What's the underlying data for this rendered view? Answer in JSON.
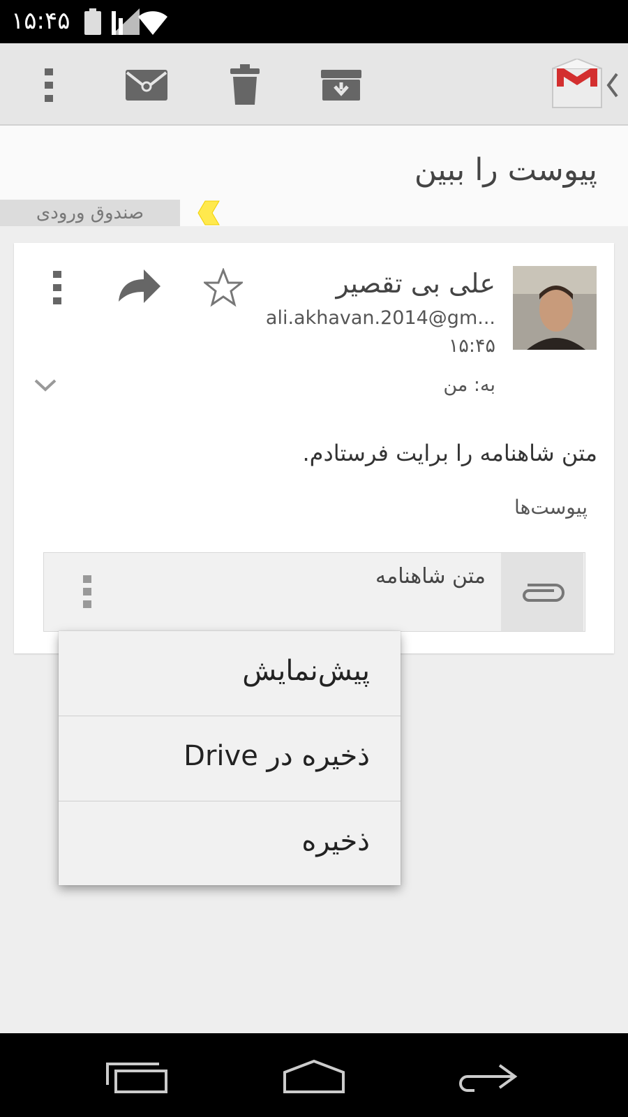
{
  "status_bar": {
    "time": "۱۵:۴۵"
  },
  "toolbar": {
    "icons": [
      "overflow-menu-icon",
      "mark-unread-icon",
      "delete-icon",
      "archive-icon",
      "gmail-logo-icon",
      "back-chevron-icon"
    ]
  },
  "conversation": {
    "subject": "پیوست را ببین",
    "label": "صندوق ورودی"
  },
  "message": {
    "sender_name": "علی بی تقصیر",
    "sender_email": "ali.akhavan.2014@gm...",
    "time": "۱۵:۴۵",
    "to_line": "به: من",
    "body": "متن شاهنامه را برایت فرستادم.",
    "attachments_heading": "پیوست‌ها"
  },
  "attachment": {
    "name": "متن شاهنامه"
  },
  "popup_menu": {
    "items": [
      {
        "label": "پیش‌نمایش"
      },
      {
        "label": "ذخیره در Drive"
      },
      {
        "label": "ذخیره"
      }
    ]
  },
  "colors": {
    "gmail_red": "#d32f2f",
    "label_yellow": "#ffe94d",
    "icon_gray": "#666666"
  }
}
